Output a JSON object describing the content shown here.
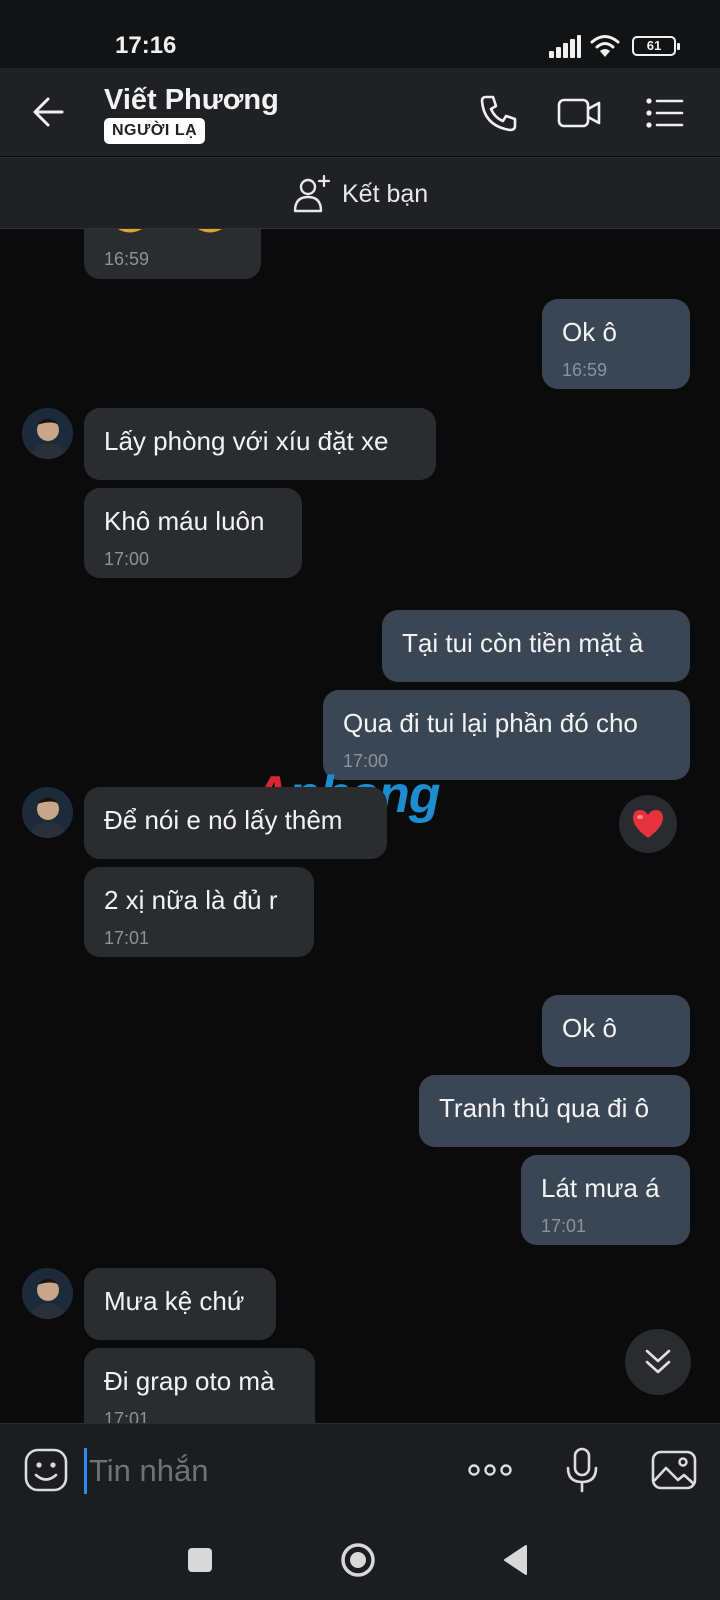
{
  "status_bar": {
    "time": "17:16",
    "battery": "61"
  },
  "header": {
    "contact_name": "Viết Phương",
    "badge": "NGƯỜI LẠ"
  },
  "add_friend": {
    "label": "Kết bạn"
  },
  "watermark": {
    "part1": "A",
    "part2": "phang"
  },
  "messages": [
    {
      "dir": "in",
      "text": "",
      "time": "16:59"
    },
    {
      "dir": "out",
      "text": "Ok ô",
      "time": "16:59"
    },
    {
      "dir": "in",
      "text": "Lấy phòng với xíu đặt xe",
      "time": ""
    },
    {
      "dir": "in",
      "text": "Khô máu luôn",
      "time": "17:00"
    },
    {
      "dir": "out",
      "text": "Tại tui còn tiền mặt à",
      "time": ""
    },
    {
      "dir": "out",
      "text": "Qua đi tui lại phần đó cho",
      "time": "17:00"
    },
    {
      "dir": "in",
      "text": "Để nói e nó lấy thêm",
      "time": ""
    },
    {
      "dir": "in",
      "text": "2 xị nữa là đủ r",
      "time": "17:01"
    },
    {
      "dir": "out",
      "text": "Ok ô",
      "time": ""
    },
    {
      "dir": "out",
      "text": "Tranh thủ qua đi ô",
      "time": ""
    },
    {
      "dir": "out",
      "text": "Lát mưa á",
      "time": "17:01"
    },
    {
      "dir": "in",
      "text": "Mưa kệ chứ",
      "time": ""
    },
    {
      "dir": "in",
      "text": "Đi grap oto mà",
      "time": "17:01"
    }
  ],
  "composer": {
    "placeholder": "Tin nhắn"
  },
  "icons": {
    "back": "arrow-left-icon",
    "call": "phone-icon",
    "video": "video-camera-icon",
    "menu": "list-menu-icon",
    "add_friend": "add-user-icon",
    "sticker": "sticker-face-icon",
    "more": "more-dots-icon",
    "mic": "microphone-icon",
    "image": "image-icon",
    "heart": "heart-icon",
    "scroll": "chevron-double-down-icon"
  },
  "colors": {
    "incoming_bubble": "#2b2c2f",
    "outgoing_bubble": "#3a4653",
    "accent": "#2d8cf0",
    "heart": "#e5323e"
  }
}
